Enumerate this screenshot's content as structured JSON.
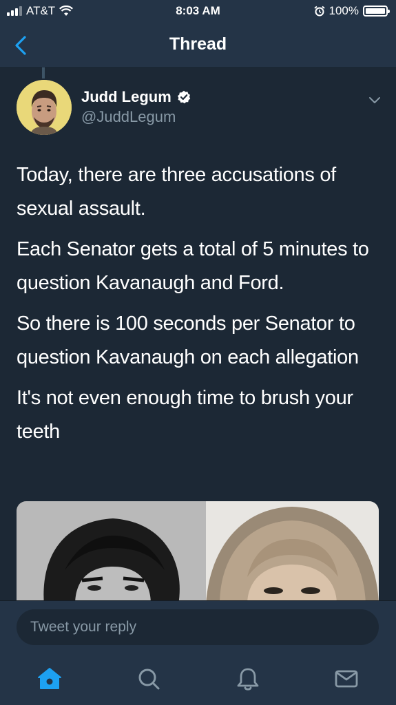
{
  "status_bar": {
    "carrier": "AT&T",
    "time": "8:03 AM",
    "battery": "100%"
  },
  "nav": {
    "title": "Thread"
  },
  "tweet": {
    "author_name": "Judd Legum",
    "author_handle": "@JuddLegum",
    "paragraphs": [
      "Today, there are three accusations of sexual assault.",
      "Each Senator gets a total of 5 minutes to question Kavanaugh and Ford.",
      "So there is 100 seconds per Senator to question Kavanaugh on each allegation",
      "It's not even enough time to brush your teeth"
    ]
  },
  "reply": {
    "placeholder": "Tweet your reply"
  },
  "tabs": [
    "home-icon",
    "search-icon",
    "notifications-icon",
    "messages-icon"
  ],
  "colors": {
    "background": "#1c2835",
    "bar": "#243447",
    "accent": "#1da1f2",
    "secondary_text": "#8899a6"
  }
}
